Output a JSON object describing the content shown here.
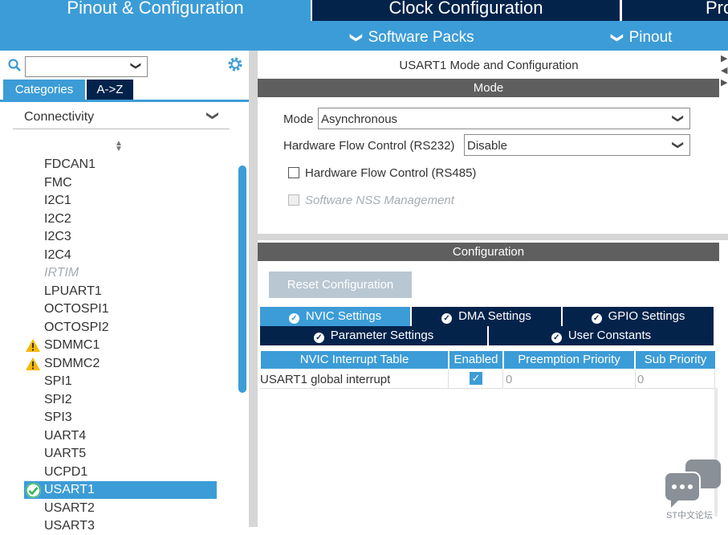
{
  "top_tabs": [
    {
      "label": "Pinout & Configuration"
    },
    {
      "label": "Clock Configuration"
    },
    {
      "label": "Pro"
    }
  ],
  "subbar": {
    "software_packs": "Software Packs",
    "pinout": "Pinout",
    "chevron": "❯"
  },
  "left": {
    "search": {
      "value": "",
      "placeholder": ""
    },
    "category_tabs": [
      "Categories",
      "A->Z"
    ],
    "section": "Connectivity",
    "items": [
      {
        "label": "FDCAN1",
        "state": "normal"
      },
      {
        "label": "FMC",
        "state": "normal"
      },
      {
        "label": "I2C1",
        "state": "normal"
      },
      {
        "label": "I2C2",
        "state": "normal"
      },
      {
        "label": "I2C3",
        "state": "normal"
      },
      {
        "label": "I2C4",
        "state": "normal"
      },
      {
        "label": "IRTIM",
        "state": "disabled"
      },
      {
        "label": "LPUART1",
        "state": "normal"
      },
      {
        "label": "OCTOSPI1",
        "state": "normal"
      },
      {
        "label": "OCTOSPI2",
        "state": "normal"
      },
      {
        "label": "SDMMC1",
        "state": "warning"
      },
      {
        "label": "SDMMC2",
        "state": "warning"
      },
      {
        "label": "SPI1",
        "state": "normal"
      },
      {
        "label": "SPI2",
        "state": "normal"
      },
      {
        "label": "SPI3",
        "state": "normal"
      },
      {
        "label": "UART4",
        "state": "normal"
      },
      {
        "label": "UART5",
        "state": "normal"
      },
      {
        "label": "UCPD1",
        "state": "normal"
      },
      {
        "label": "USART1",
        "state": "selected"
      },
      {
        "label": "USART2",
        "state": "normal"
      },
      {
        "label": "USART3",
        "state": "normal"
      }
    ]
  },
  "right": {
    "title": "USART1 Mode and Configuration",
    "mode_header": "Mode",
    "mode_label": "Mode",
    "mode_value": "Asynchronous",
    "hwfc232_label": "Hardware Flow Control (RS232)",
    "hwfc232_value": "Disable",
    "hwfc485_label": "Hardware Flow Control (RS485)",
    "nss_label": "Software NSS Management",
    "config_header": "Configuration",
    "reset_label": "Reset Configuration",
    "settings_tabs": {
      "nvic": "NVIC Settings",
      "dma": "DMA Settings",
      "gpio": "GPIO Settings",
      "param": "Parameter Settings",
      "user": "User Constants"
    },
    "table": {
      "headers": [
        "NVIC Interrupt Table",
        "Enabled",
        "Preemption Priority",
        "Sub Priority"
      ],
      "rows": [
        {
          "name": "USART1 global interrupt",
          "enabled": true,
          "preemption": "0",
          "sub": "0"
        }
      ]
    }
  },
  "watermark": "ST中文论坛",
  "colors": {
    "accent": "#3c9cd7",
    "navy": "#03234b",
    "header_gray": "#5f5f5f",
    "warning": "#f5b800",
    "ok_green": "#2eb55a"
  }
}
